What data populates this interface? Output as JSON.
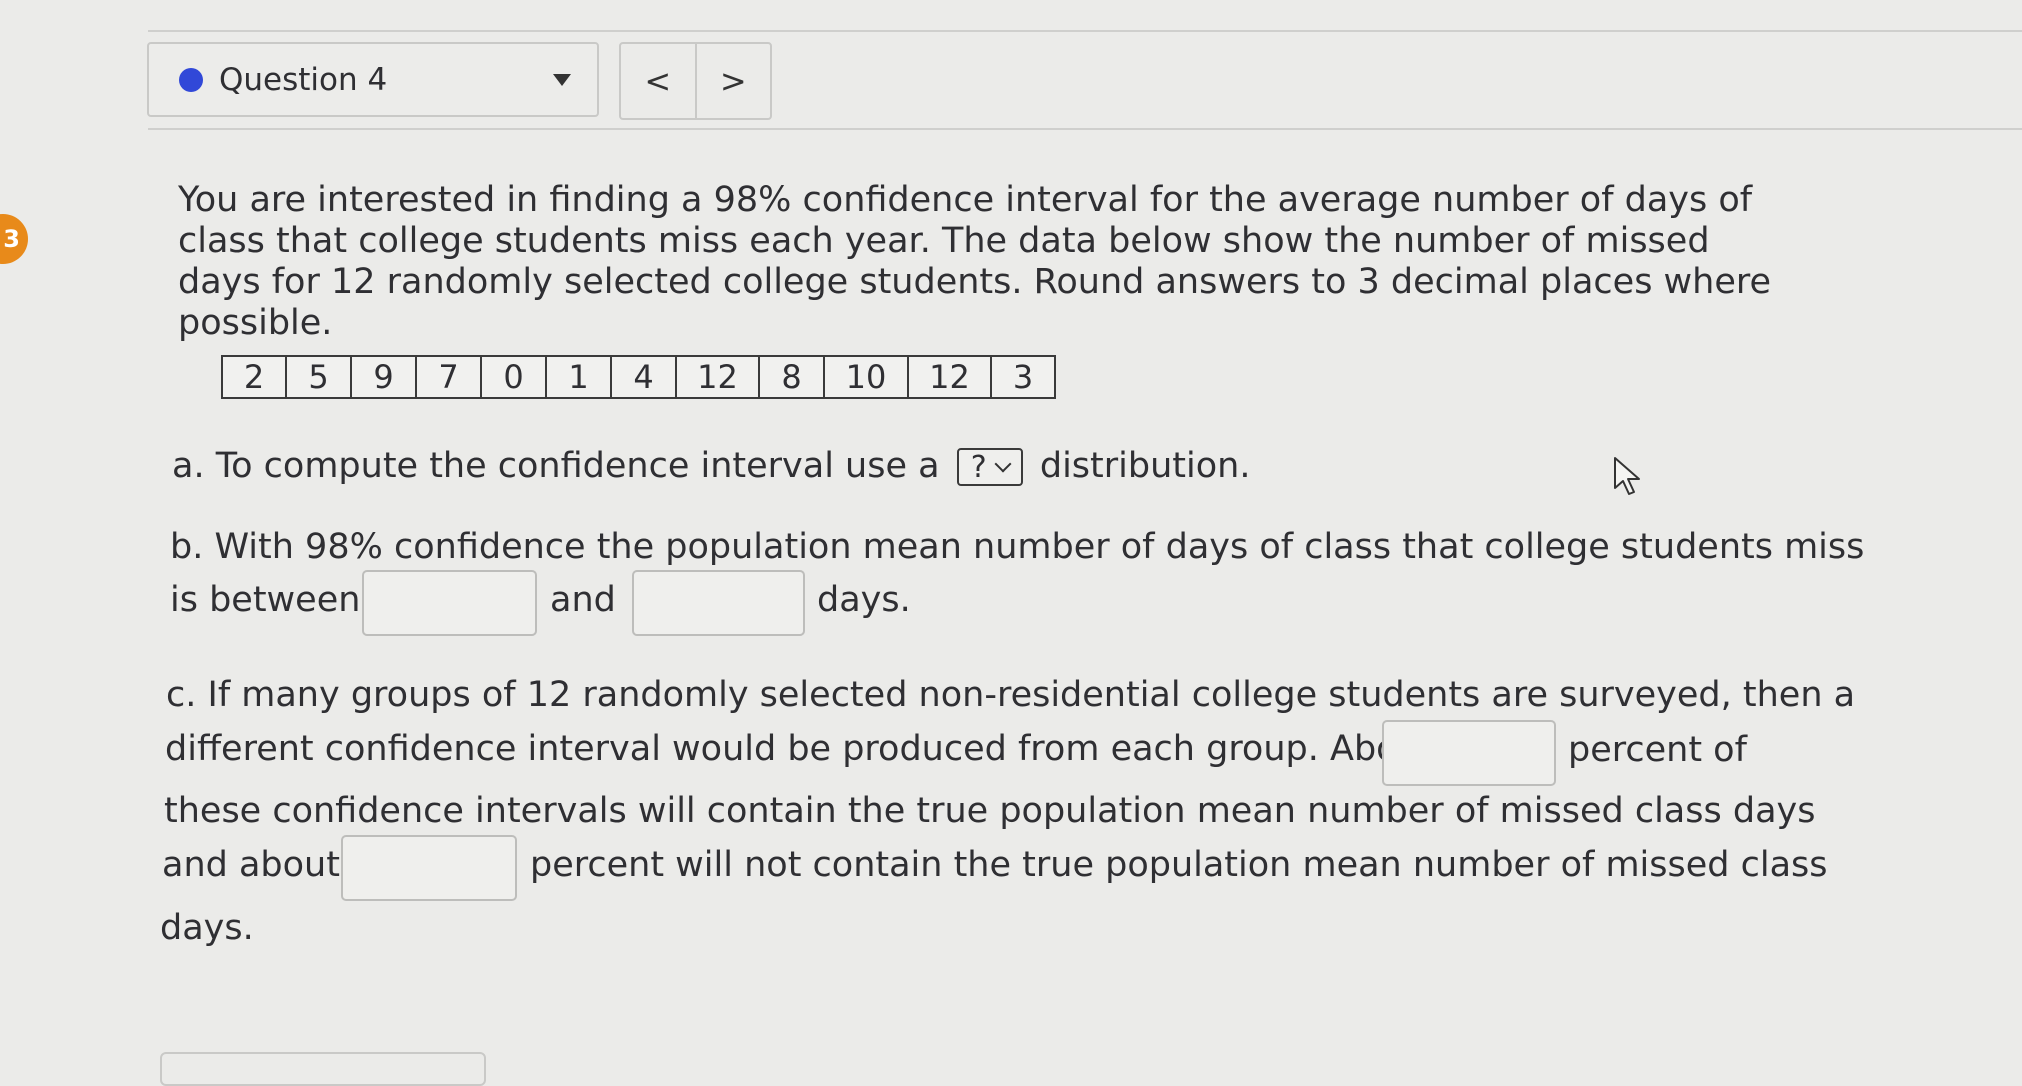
{
  "question_selector": {
    "label": "Question 4"
  },
  "nav": {
    "prev": "<",
    "next": ">"
  },
  "badge": "3",
  "prompt": "You are interested in finding a 98% confidence interval for the average number of days of class that college students miss each year. The data below show the number of missed days for 12 randomly selected college students. Round answers to 3 decimal places where possible.",
  "data_values": [
    "2",
    "5",
    "9",
    "7",
    "0",
    "1",
    "4",
    "12",
    "8",
    "10",
    "12",
    "3"
  ],
  "part_a": {
    "prefix": "a. To compute the confidence interval use a",
    "select_value": "?",
    "suffix": "distribution."
  },
  "part_b": {
    "line1": "b. With 98% confidence the population mean number of days of class that college students miss",
    "prefix": "is between",
    "middle": "and",
    "suffix": "days."
  },
  "part_c": {
    "line1": "c. If many groups of 12 randomly selected non-residential college students are surveyed, then a",
    "line2_prefix": "different confidence interval would be produced from each group. About",
    "line2_suffix": "percent of",
    "line3": "these confidence intervals will contain the true population mean number of missed class days",
    "line4_prefix": "and about",
    "line4_suffix": "percent will not contain the true population mean number of missed class",
    "line5": "days."
  }
}
